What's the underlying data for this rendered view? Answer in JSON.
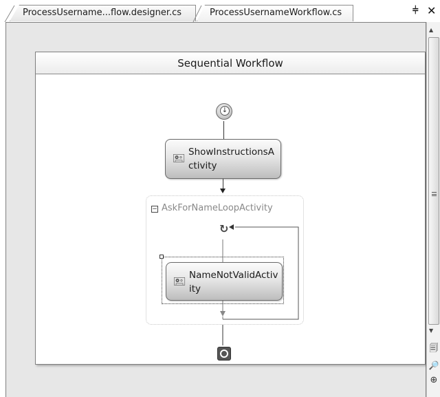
{
  "tabs": [
    {
      "label": "ProcessUsername...flow.designer.cs",
      "active": false
    },
    {
      "label": "ProcessUsernameWorkflow.cs",
      "active": true
    }
  ],
  "window_controls": {
    "pin_glyph": "⨡",
    "close_glyph": "✕"
  },
  "workflow": {
    "title": "Sequential Workflow",
    "start_icon": "workflow-start-icon",
    "end_icon": "workflow-end-icon",
    "activities": [
      {
        "label": "ShowInstructionsActivity",
        "icon": "code-activity-icon"
      }
    ],
    "loop": {
      "label": "AskForNameLoopActivity",
      "collapse_glyph": "⊟",
      "loop_glyph": "↻",
      "child": {
        "label": "NameNotValidActivity",
        "icon": "code-activity-icon",
        "selected": true
      }
    }
  },
  "scrollbar": {
    "tools": [
      "bookmark-icon",
      "find-icon",
      "zoom-icon"
    ]
  }
}
